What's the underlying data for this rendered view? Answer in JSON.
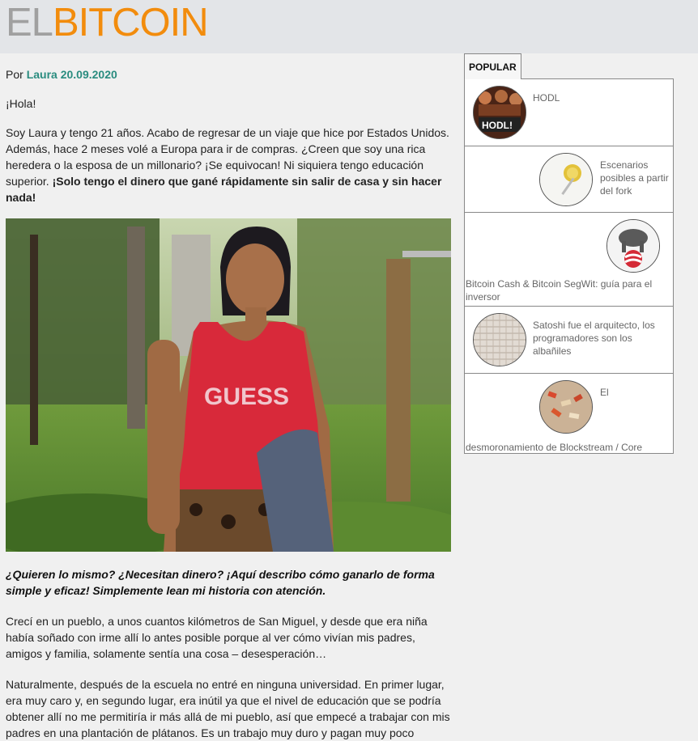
{
  "site": {
    "logo_el": "EL",
    "logo_bitcoin": "BITCOIN"
  },
  "byline": {
    "prefix": "Por ",
    "author": "Laura",
    "date": "20.09.2020"
  },
  "article": {
    "greeting": "¡Hola!",
    "intro_regular": "Soy Laura y tengo 21 años. Acabo de regresar de un viaje que hice por Estados Unidos. Además, hace 2 meses volé a Europa para ir de compras. ¿Creen que soy una rica heredera o la esposa de un millonario? ¡Se equivocan! Ni siquiera tengo educación superior. ",
    "intro_bold": "¡Solo tengo el dinero que gané rápidamente sin salir de casa y sin hacer nada!",
    "question": "¿Quieren lo mismo? ¿Necesitan dinero? ¡Aquí describo cómo ganarlo de forma simple y eficaz! Simplemente lean mi historia con atención.",
    "para_grew_up": "Crecí en un pueblo, a unos cuantos kilómetros de San Miguel, y desde que era niña había soñado con irme allí lo antes posible porque al ver cómo vivían mis padres, amigos y familia, solamente sentía una cosa – desesperación…",
    "para_naturally": "Naturalmente, después de la escuela no entré en ninguna universidad. En primer lugar, era muy caro y, en segundo lugar, era inútil ya que el nivel de educación que se podría obtener allí no me permitiría ir más allá de mi pueblo, así que empecé a trabajar con mis padres en una plantación de plátanos. Es un trabajo muy duro y pagan muy poco"
  },
  "sidebar": {
    "tab_label": "POPULAR",
    "items": [
      {
        "title": "HODL",
        "thumb_text": "HODL!"
      },
      {
        "title": "Escenarios posibles a partir del fork"
      },
      {
        "title": "Bitcoin Cash & Bitcoin SegWit: guía para el inversor"
      },
      {
        "title": "Satoshi fue el arquitecto, los programadores son los albañiles"
      },
      {
        "title_part1": "El",
        "title_part2": "desmoronamiento de Blockstream / Core"
      }
    ]
  },
  "colors": {
    "accent_orange": "#f28c0d",
    "link_teal": "#2a8c7f",
    "logo_gray": "#a0a0a0"
  }
}
